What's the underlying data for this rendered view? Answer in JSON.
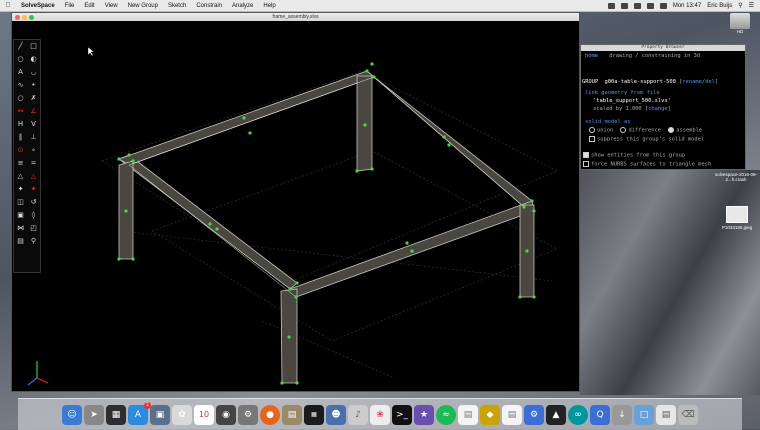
{
  "menubar": {
    "app_name": "SolveSpace",
    "items": [
      "File",
      "Edit",
      "View",
      "New Group",
      "Sketch",
      "Constrain",
      "Analyze",
      "Help"
    ],
    "clock": "Mon 13:47",
    "user": "Eric Buijs"
  },
  "window": {
    "title": "frame_assembly.slvs"
  },
  "toolbar": {
    "tools": [
      "line",
      "rectangle",
      "circle",
      "arc",
      "text",
      "tangent-arc",
      "spline",
      "point",
      "construction",
      "split",
      "distance",
      "angle",
      "horizontal",
      "vertical",
      "parallel",
      "perpendicular",
      "on-point",
      "midpoint",
      "symmetric",
      "equal",
      "tangent",
      "ref",
      "nearest-iso",
      "nearest-ortho",
      "step-translate",
      "step-rotate",
      "extrude",
      "lathe",
      "assemble",
      "sketch-plane",
      "show-hide",
      "zoom"
    ]
  },
  "property_browser": {
    "title": "Property Browser",
    "nav_home": "home",
    "nav_mode": "drawing / constraining in 3d",
    "group_label": "GROUP",
    "group_name": "g00a-table-support-500",
    "rename": "rename",
    "del": "del",
    "link_header": "link geometry from file",
    "file_name": "'table_support_500.slvs'",
    "scaled": "scaled by 1.000",
    "change": "change",
    "solid_header": "solid model as",
    "opt_union": "union",
    "opt_difference": "difference",
    "opt_assemble": "assemble",
    "suppress": "suppress this group's solid model",
    "show_entities": "show entities from this group",
    "force_nurbs": "force NURBS surfaces to triangle mesh"
  },
  "desktop": {
    "labels": [
      "HD",
      "solvespace-2016-09-2...h.crash",
      "P1033185.jpeg"
    ]
  },
  "dock": {
    "badge_count": "1",
    "calendar_day": "10"
  },
  "colors": {
    "beam_fill": "#4a4741",
    "beam_stroke": "#c8c4bd",
    "vertex_green": "#39e33a",
    "accent_blue": "#57a6ff"
  }
}
